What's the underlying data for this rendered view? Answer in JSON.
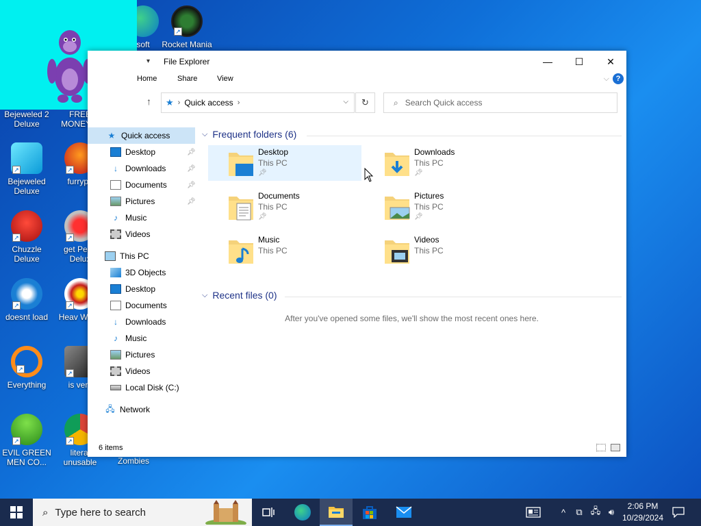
{
  "desktop": {
    "icons": [
      {
        "label": "soft",
        "id": "microsoft"
      },
      {
        "label": "Rocket Mania",
        "id": "rocket-mania"
      },
      {
        "label": "Bejeweled 2 Deluxe",
        "id": "bejeweled-2"
      },
      {
        "label": "FREE MONEY....",
        "id": "free-money"
      },
      {
        "label": "Bejeweled Deluxe",
        "id": "bejeweled"
      },
      {
        "label": "furrypo",
        "id": "furrypo"
      },
      {
        "label": "Chuzzle Deluxe",
        "id": "chuzzle"
      },
      {
        "label": "get Pegg Delux",
        "id": "peggle"
      },
      {
        "label": "doesnt load",
        "id": "doesnt-load"
      },
      {
        "label": "Heav Weap",
        "id": "heavy-weapon"
      },
      {
        "label": "Everything",
        "id": "everything"
      },
      {
        "label": "is very",
        "id": "is-very"
      },
      {
        "label": "EVIL GREEN MEN CO...",
        "id": "evil-green-men"
      },
      {
        "label": "literal unusable",
        "id": "literal-unusable"
      },
      {
        "label": "Zombies",
        "id": "zombies"
      }
    ]
  },
  "window": {
    "title": "File Explorer",
    "minimize": "—",
    "maximize": "☐",
    "close": "✕",
    "tabs": [
      "Home",
      "Share",
      "View"
    ],
    "help": "?",
    "address": {
      "path": "Quick access"
    },
    "search": {
      "placeholder": "Search Quick access"
    }
  },
  "nav": {
    "quick_access": "Quick access",
    "quick_items": [
      {
        "label": "Desktop",
        "icon": "desktop-icon",
        "pinned": true
      },
      {
        "label": "Downloads",
        "icon": "downloads-icon",
        "pinned": true
      },
      {
        "label": "Documents",
        "icon": "documents-icon",
        "pinned": true
      },
      {
        "label": "Pictures",
        "icon": "pictures-icon",
        "pinned": true
      },
      {
        "label": "Music",
        "icon": "music-icon",
        "pinned": false
      },
      {
        "label": "Videos",
        "icon": "videos-icon",
        "pinned": false
      }
    ],
    "this_pc": "This PC",
    "pc_items": [
      {
        "label": "3D Objects",
        "icon": "3d-objects-icon"
      },
      {
        "label": "Desktop",
        "icon": "desktop-icon"
      },
      {
        "label": "Documents",
        "icon": "documents-icon"
      },
      {
        "label": "Downloads",
        "icon": "downloads-icon"
      },
      {
        "label": "Music",
        "icon": "music-icon"
      },
      {
        "label": "Pictures",
        "icon": "pictures-icon"
      },
      {
        "label": "Videos",
        "icon": "videos-icon"
      },
      {
        "label": "Local Disk (C:)",
        "icon": "drive-icon"
      }
    ],
    "network": "Network"
  },
  "content": {
    "frequent_header": "Frequent folders (6)",
    "folders": [
      {
        "name": "Desktop",
        "location": "This PC",
        "pinned": true,
        "icon": "desktop-folder-icon"
      },
      {
        "name": "Downloads",
        "location": "This PC",
        "pinned": true,
        "icon": "downloads-folder-icon"
      },
      {
        "name": "Documents",
        "location": "This PC",
        "pinned": true,
        "icon": "documents-folder-icon"
      },
      {
        "name": "Pictures",
        "location": "This PC",
        "pinned": true,
        "icon": "pictures-folder-icon"
      },
      {
        "name": "Music",
        "location": "This PC",
        "pinned": false,
        "icon": "music-folder-icon"
      },
      {
        "name": "Videos",
        "location": "This PC",
        "pinned": false,
        "icon": "videos-folder-icon"
      }
    ],
    "recent_header": "Recent files (0)",
    "recent_empty": "After you've opened some files, we'll show the most recent ones here."
  },
  "status": {
    "items": "6 items"
  },
  "taskbar": {
    "search_placeholder": "Type here to search",
    "time": "2:06 PM",
    "date": "10/29/2024"
  },
  "colors": {
    "accent": "#0078d7",
    "selection": "#cce4f7",
    "header_text": "#1e3287"
  }
}
